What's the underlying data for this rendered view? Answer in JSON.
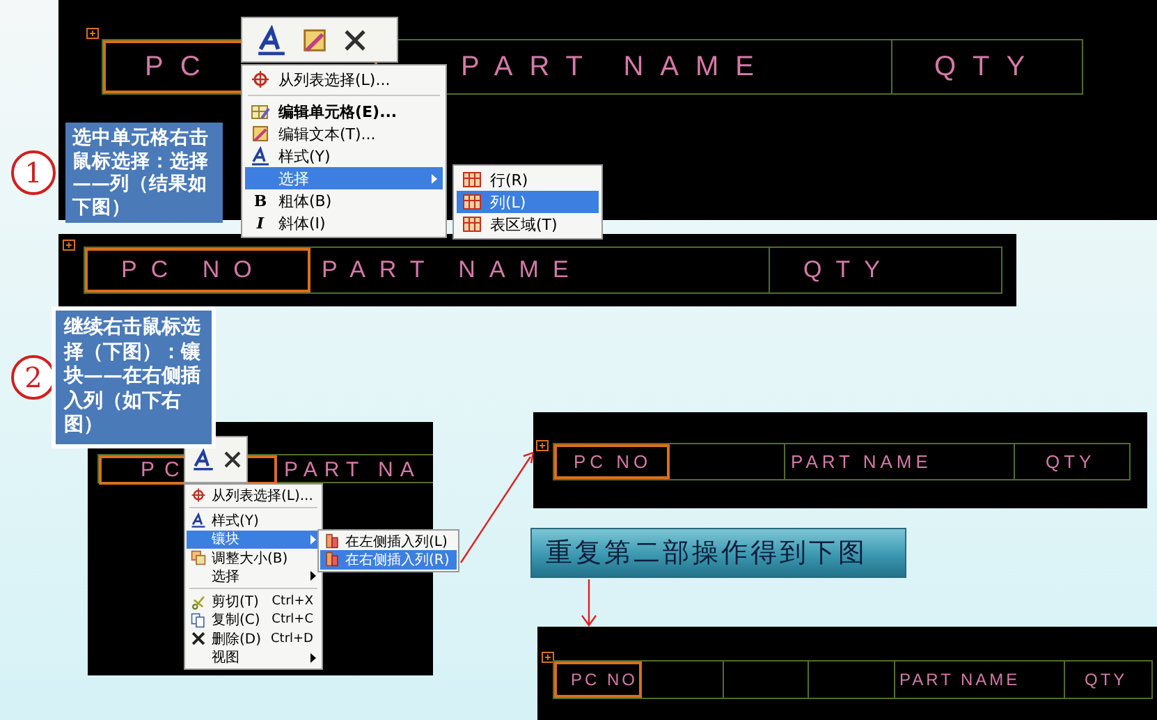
{
  "steps": [
    {
      "number": "1",
      "note": "选中单元格右击鼠标选择：选择——列（结果如下图）"
    },
    {
      "number": "2",
      "note": "继续右击鼠标选择（下图）：镶块——在右侧插入列（如下右图）"
    }
  ],
  "screen_1": {
    "table": {
      "cells": [
        {
          "text": "PC",
          "selected": true
        },
        {
          "text": "PART NAME",
          "selected": false
        },
        {
          "text": "QTY",
          "selected": false
        }
      ]
    },
    "context_menu": {
      "items": [
        {
          "kind": "item",
          "label": "从列表选择(L)...",
          "bold": false,
          "selected": false
        },
        {
          "kind": "separator"
        },
        {
          "kind": "item",
          "label": "编辑单元格(E)...",
          "bold": true,
          "selected": false
        },
        {
          "kind": "item",
          "label": "编辑文本(T)...",
          "bold": false,
          "selected": false
        },
        {
          "kind": "item",
          "label": "样式(Y)",
          "bold": false,
          "selected": false
        },
        {
          "kind": "submenu",
          "label": "选择",
          "bold": false,
          "selected": true
        },
        {
          "kind": "item",
          "glyph": "B",
          "label": "粗体(B)",
          "bold": false,
          "selected": false
        },
        {
          "kind": "item",
          "glyph": "I",
          "label": "斜体(I)",
          "bold": false,
          "selected": false
        }
      ]
    },
    "submenu": {
      "items": [
        {
          "kind": "item",
          "label": "行(R)",
          "selected": false
        },
        {
          "kind": "item",
          "label": "列(L)",
          "selected": true
        },
        {
          "kind": "item",
          "label": "表区域(T)",
          "selected": false
        }
      ]
    }
  },
  "screen_2": {
    "table": {
      "cells": [
        {
          "text": "PC NO",
          "selected": true
        },
        {
          "text": "PART NAME",
          "selected": false
        },
        {
          "text": "QTY",
          "selected": false
        }
      ]
    }
  },
  "screen_3": {
    "table": {
      "cells": [
        {
          "text": "PC",
          "selected": true
        },
        {
          "text": "PART NA",
          "selected": false
        }
      ]
    },
    "context_menu": {
      "items": [
        {
          "kind": "item",
          "label": "从列表选择(L)...",
          "selected": false
        },
        {
          "kind": "separator"
        },
        {
          "kind": "item",
          "label": "样式(Y)",
          "selected": false
        },
        {
          "kind": "submenu",
          "label": "镶块",
          "selected": true
        },
        {
          "kind": "item",
          "label": "调整大小(B)",
          "selected": false
        },
        {
          "kind": "submenu",
          "label": "选择",
          "selected": false
        },
        {
          "kind": "separator"
        },
        {
          "kind": "item",
          "label": "剪切(T)",
          "shortcut": "Ctrl+X",
          "selected": false
        },
        {
          "kind": "item",
          "label": "复制(C)",
          "shortcut": "Ctrl+C",
          "selected": false
        },
        {
          "kind": "item",
          "label": "删除(D)",
          "shortcut": "Ctrl+D",
          "selected": false
        },
        {
          "kind": "submenu",
          "label": "视图",
          "selected": false
        }
      ]
    },
    "submenu": {
      "items": [
        {
          "kind": "item",
          "label": "在左侧插入列(L)",
          "selected": false
        },
        {
          "kind": "item",
          "label": "在右侧插入列(R)",
          "selected": true
        }
      ]
    }
  },
  "screen_4": {
    "table": {
      "cells": [
        {
          "text": "PC NO",
          "selected": true
        },
        {
          "selected": false
        },
        {
          "text": "PART NAME",
          "selected": false
        },
        {
          "text": "QTY",
          "selected": false
        }
      ]
    }
  },
  "caption": "重复第二部操作得到下图",
  "screen_5": {
    "table": {
      "cells": [
        {
          "text": "PC NO",
          "selected": true
        },
        {
          "selected": false
        },
        {
          "selected": false
        },
        {
          "selected": false
        },
        {
          "text": "PART NAME",
          "selected": false
        },
        {
          "text": "QTY",
          "selected": false
        }
      ]
    }
  }
}
